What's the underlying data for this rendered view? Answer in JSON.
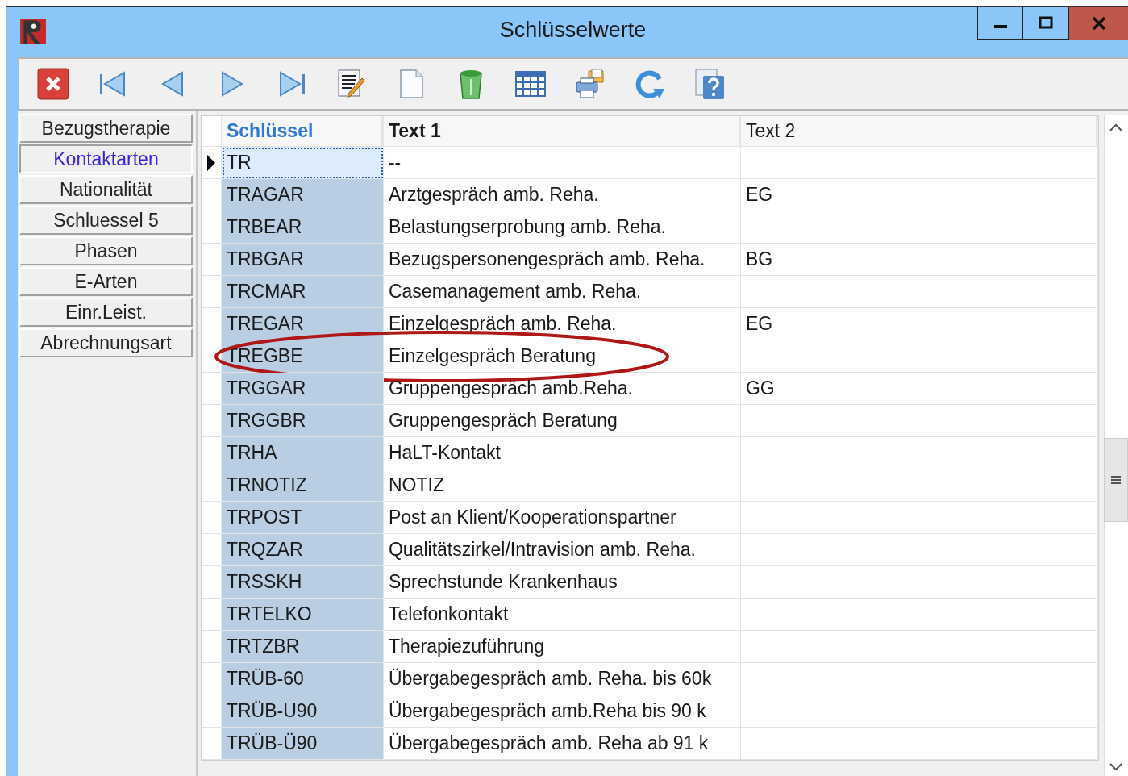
{
  "window": {
    "title": "Schlüsselwerte"
  },
  "sidebar": {
    "items": [
      {
        "label": "Bezugstherapie",
        "selected": false
      },
      {
        "label": "Kontaktarten",
        "selected": true
      },
      {
        "label": "Nationalität",
        "selected": false
      },
      {
        "label": "Schluessel 5",
        "selected": false
      },
      {
        "label": "Phasen",
        "selected": false
      },
      {
        "label": "E-Arten",
        "selected": false
      },
      {
        "label": "Einr.Leist.",
        "selected": false
      },
      {
        "label": "Abrechnungsart",
        "selected": false
      }
    ]
  },
  "table": {
    "columns": [
      {
        "label": "Schlüssel",
        "sorted": true
      },
      {
        "label": "Text 1",
        "sorted": false
      },
      {
        "label": "Text 2",
        "sorted": false
      }
    ],
    "rows": [
      {
        "key": "TR",
        "text1": "--",
        "text2": "",
        "selected": true,
        "circled": false
      },
      {
        "key": "TRAGAR",
        "text1": "Arztgespräch amb. Reha.",
        "text2": "EG",
        "selected": false,
        "circled": false
      },
      {
        "key": "TRBEAR",
        "text1": "Belastungserprobung amb. Reha.",
        "text2": "",
        "selected": false,
        "circled": false
      },
      {
        "key": "TRBGAR",
        "text1": "Bezugspersonengespräch amb. Reha.",
        "text2": "BG",
        "selected": false,
        "circled": false
      },
      {
        "key": "TRCMAR",
        "text1": "Casemanagement amb. Reha.",
        "text2": "",
        "selected": false,
        "circled": false
      },
      {
        "key": "TREGAR",
        "text1": "Einzelgespräch amb. Reha.",
        "text2": "EG",
        "selected": false,
        "circled": false
      },
      {
        "key": "TREGBE",
        "text1": "Einzelgespräch Beratung",
        "text2": "",
        "selected": false,
        "circled": true
      },
      {
        "key": "TRGGAR",
        "text1": "Gruppengespräch amb.Reha.",
        "text2": "GG",
        "selected": false,
        "circled": false
      },
      {
        "key": "TRGGBR",
        "text1": "Gruppengespräch Beratung",
        "text2": "",
        "selected": false,
        "circled": false
      },
      {
        "key": "TRHA",
        "text1": "HaLT-Kontakt",
        "text2": "",
        "selected": false,
        "circled": false
      },
      {
        "key": "TRNOTIZ",
        "text1": "NOTIZ",
        "text2": "",
        "selected": false,
        "circled": false
      },
      {
        "key": "TRPOST",
        "text1": "Post an Klient/Kooperationspartner",
        "text2": "",
        "selected": false,
        "circled": false
      },
      {
        "key": "TRQZAR",
        "text1": "Qualitätszirkel/Intravision amb. Reha.",
        "text2": "",
        "selected": false,
        "circled": false
      },
      {
        "key": "TRSSKH",
        "text1": "Sprechstunde Krankenhaus",
        "text2": "",
        "selected": false,
        "circled": false
      },
      {
        "key": "TRTELKO",
        "text1": "Telefonkontakt",
        "text2": "",
        "selected": false,
        "circled": false
      },
      {
        "key": "TRTZBR",
        "text1": "Therapiezuführung",
        "text2": "",
        "selected": false,
        "circled": false
      },
      {
        "key": "TRÜB-60",
        "text1": "Übergabegespräch amb. Reha. bis 60k",
        "text2": "",
        "selected": false,
        "circled": false
      },
      {
        "key": "TRÜB-U90",
        "text1": "Übergabegespräch amb.Reha bis 90 k",
        "text2": "",
        "selected": false,
        "circled": false
      },
      {
        "key": "TRÜB-Ü90",
        "text1": "Übergabegespräch amb. Reha ab 91 k",
        "text2": "",
        "selected": false,
        "circled": false
      }
    ]
  }
}
